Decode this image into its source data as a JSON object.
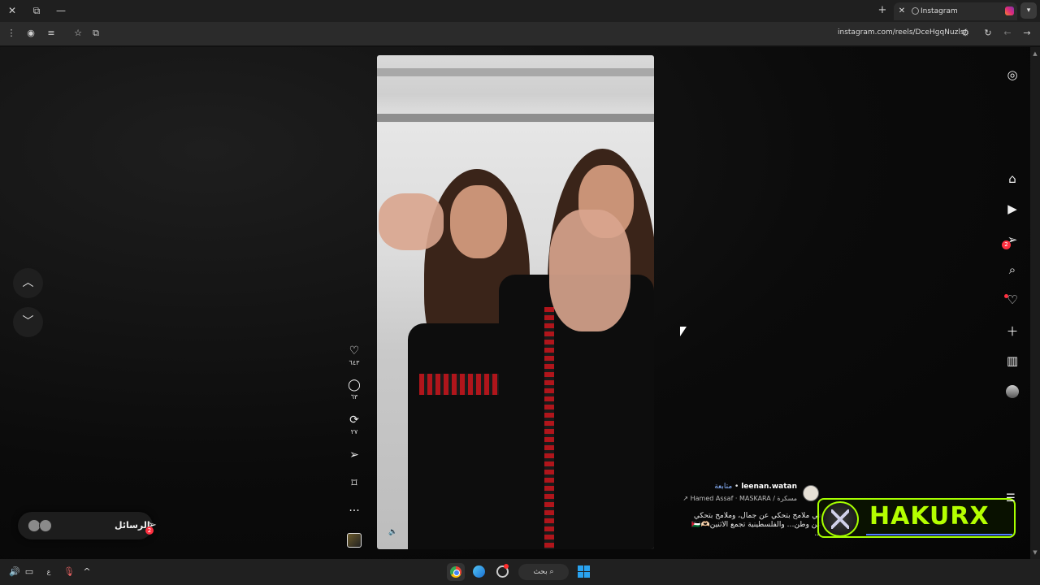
{
  "browser": {
    "tab_title": "Instagram",
    "url": "instagram.com/reels/DceHgqNuzls/",
    "close_symbol": "✕",
    "new_tab_symbol": "+"
  },
  "left_nav": {
    "prev_symbol": "︿",
    "next_symbol": "﹀"
  },
  "actions": {
    "likes": "٦٤٣",
    "comments": "٦٣",
    "reposts": "٢٧"
  },
  "messages": {
    "label": "الرسائل",
    "badge": "2"
  },
  "rail": {
    "messages_badge": "2"
  },
  "post": {
    "username": "leenan.watan",
    "follow_label": "متابعة",
    "music": "مسكرة / Hamed Assaf · MASKARA ↗",
    "caption_line1": "في ملامح بتحكي عن جمال، وملامح بتحكي",
    "caption_line2": "عن وطن… والفلسطينية تجمع الاثنين🫶🏻🇵🇸",
    "caption_more": "..."
  },
  "watermark": {
    "text": "HAKURX"
  },
  "taskbar": {
    "search_label": "بحث"
  },
  "icons": {
    "accent_color": "#a6ff00",
    "notification_color": "#ff3040",
    "follow_color": "#8ab4ff"
  }
}
